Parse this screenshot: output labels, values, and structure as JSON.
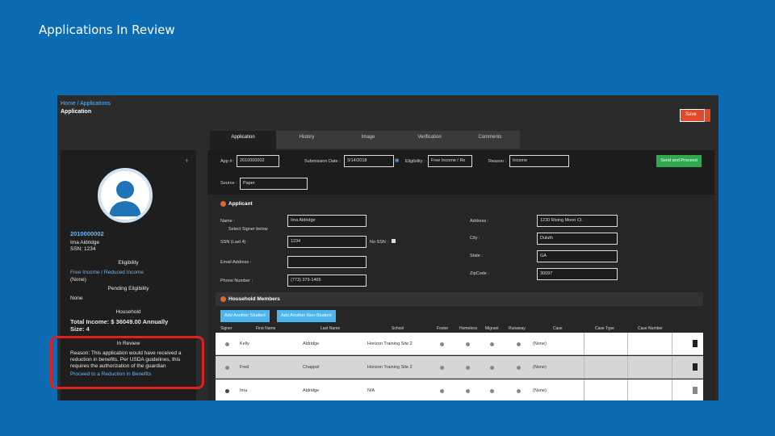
{
  "slide": {
    "title": "Applications In Review"
  },
  "app": {
    "breadcrumb": "Home / Applications",
    "subtitle": "Application",
    "save_label": "Save",
    "tabs": [
      "Application",
      "History",
      "Image",
      "Verification",
      "Comments"
    ]
  },
  "applicant_panel": {
    "app_id": "2010000002",
    "name": "Ima Aldridge",
    "ssn": "SSN: 1234",
    "eligibility_label": "Eligibility",
    "eligibility_value": "Free Income / Reduced Income",
    "eligibility_sub": "(None)",
    "pending_label": "Pending Eligibility",
    "pending_value": "None",
    "household_label": "Household",
    "total_income": "Total Income: $ 36049.00 Annually",
    "size": "Size: 4",
    "review_label": "In Review",
    "review_reason": "Reason: This application would have received a reduction in benefits. Per USDA guidelines, this requires the authorization of the guardian",
    "review_link": "Proceed to a Reduction in Benefits"
  },
  "form": {
    "app_label": "App # :",
    "app_value": "2010000002",
    "submission_label": "Submission Date :",
    "submission_value": "3/14/2018",
    "eligibility_label": "Eligibility :",
    "eligibility_value": "Free Income / Re",
    "reason_label": "Reason :",
    "reason_value": "Income",
    "source_label": "Source :",
    "source_value": "Paper",
    "send_label": "Send and Proceed",
    "applicant_title": "Applicant",
    "name_label": "Name :",
    "name_value": "Ima Aldridge",
    "select_signer": "Select Signer below",
    "ssn_label": "SSN (Last 4) :",
    "ssn_value": "1234",
    "no_ssn_label": "No SSN :",
    "email_label": "Email Address :",
    "email_value": "",
    "phone_label": "Phone Number :",
    "phone_value": "(773) 379-1465",
    "address_label": "Address :",
    "address_value": "1230 Rising Moon Ct.",
    "city_label": "City :",
    "city_value": "Duluth",
    "state_label": "State :",
    "state_value": "GA",
    "zip_label": "ZipCode :",
    "zip_value": "30097"
  },
  "household": {
    "title": "Household Members",
    "add_student": "Add Another Student",
    "add_non_student": "Add Another Non-Student",
    "columns": [
      "Signer",
      "First Name",
      "Last Name",
      "School",
      "Foster",
      "Homeless",
      "Migrant",
      "Runaway",
      "Case",
      "Case Type",
      "Case Number"
    ],
    "rows": [
      {
        "first": "Kelly",
        "last": "Aldridge",
        "school": "Horizon Training Site 2",
        "case": "(None)"
      },
      {
        "first": "Fred",
        "last": "Chappel",
        "school": "Horizon Training Site 2",
        "case": "(None)"
      },
      {
        "first": "Ima",
        "last": "Aldridge",
        "school": "N/A",
        "case": "(None)"
      }
    ]
  },
  "colors": {
    "accent": "#0B6BB3",
    "highlight": "#e01f1f",
    "save": "#e04a2a",
    "proceed": "#2fa84f",
    "add": "#4bb6ef"
  }
}
